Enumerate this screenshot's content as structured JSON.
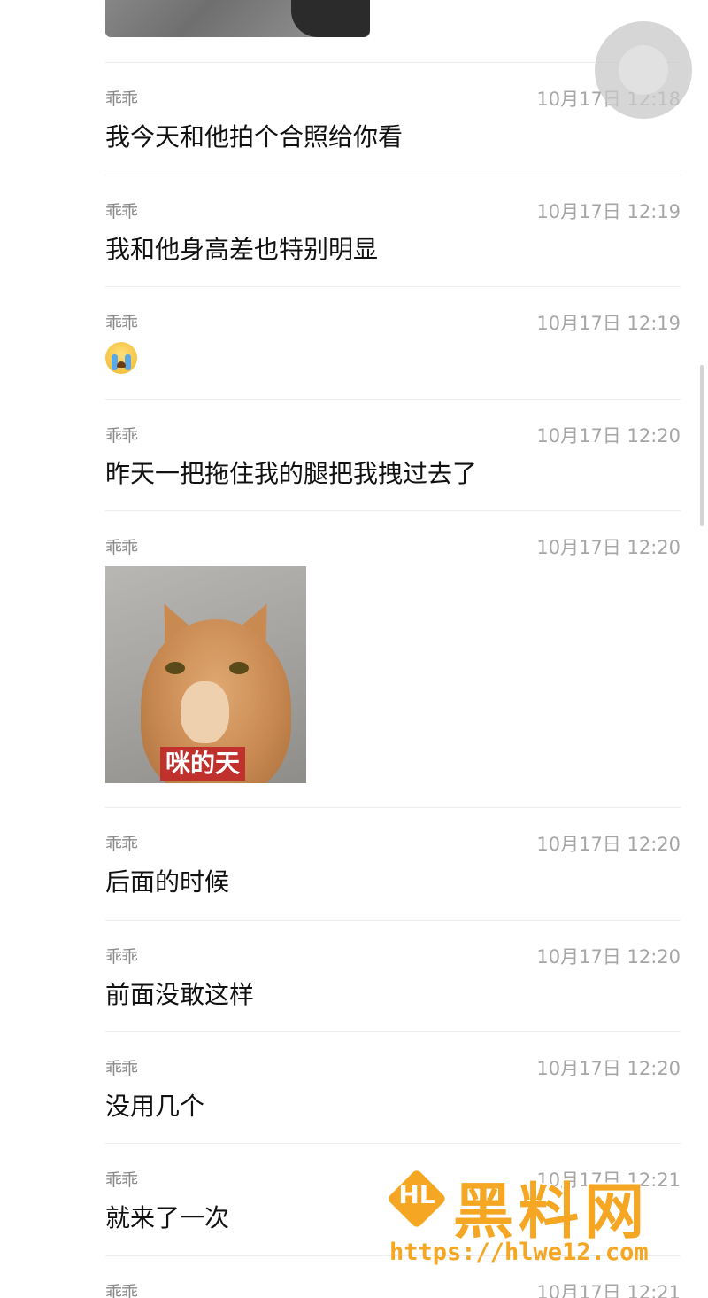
{
  "messages": [
    {
      "sender": "乖乖",
      "time": "10月17日 12:18",
      "text": "我今天和他拍个合照给你看"
    },
    {
      "sender": "乖乖",
      "time": "10月17日 12:19",
      "text": "我和他身高差也特别明显"
    },
    {
      "sender": "乖乖",
      "time": "10月17日 12:19",
      "emoji": "crying-face-emoji"
    },
    {
      "sender": "乖乖",
      "time": "10月17日 12:20",
      "text": "昨天一把拖住我的腿把我拽过去了"
    },
    {
      "sender": "乖乖",
      "time": "10月17日 12:20",
      "image_caption": "咪的天",
      "image": "cat-meme"
    },
    {
      "sender": "乖乖",
      "time": "10月17日 12:20",
      "text": "后面的时候"
    },
    {
      "sender": "乖乖",
      "time": "10月17日 12:20",
      "text": "前面没敢这样"
    },
    {
      "sender": "乖乖",
      "time": "10月17日 12:20",
      "text": "没用几个"
    },
    {
      "sender": "乖乖",
      "time": "10月17日 12:21",
      "text": "就来了一次"
    },
    {
      "sender": "乖乖",
      "time": "10月17日 12:21"
    }
  ],
  "watermark": {
    "logo_text": "HL",
    "title": "黑料网",
    "url": "https://hlwe12.com"
  },
  "colors": {
    "watermark": "#f5a623",
    "caption_bg": "#c0302d"
  }
}
